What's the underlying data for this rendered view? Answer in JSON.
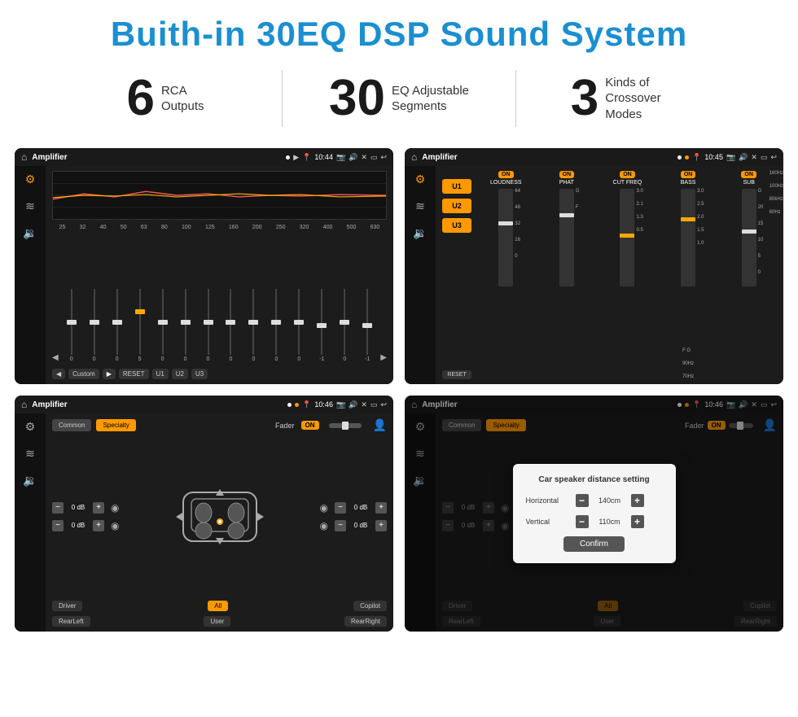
{
  "header": {
    "title": "Buith-in 30EQ DSP Sound System"
  },
  "stats": [
    {
      "number": "6",
      "label_line1": "RCA",
      "label_line2": "Outputs"
    },
    {
      "number": "30",
      "label_line1": "EQ Adjustable",
      "label_line2": "Segments"
    },
    {
      "number": "3",
      "label_line1": "Kinds of",
      "label_line2": "Crossover Modes"
    }
  ],
  "screens": [
    {
      "id": "eq-screen",
      "status": {
        "app": "Amplifier",
        "time": "10:44"
      },
      "type": "eq",
      "freq_labels": [
        "25",
        "32",
        "40",
        "50",
        "63",
        "80",
        "100",
        "125",
        "160",
        "200",
        "250",
        "320",
        "400",
        "500",
        "630"
      ],
      "eq_values": [
        "0",
        "0",
        "0",
        "5",
        "0",
        "0",
        "0",
        "0",
        "0",
        "0",
        "0",
        "-1",
        "0",
        "-1"
      ],
      "bottom_btns": [
        "Custom",
        "RESET",
        "U1",
        "U2",
        "U3"
      ]
    },
    {
      "id": "crossover-screen",
      "status": {
        "app": "Amplifier",
        "time": "10:45"
      },
      "type": "crossover",
      "presets": [
        "U1",
        "U2",
        "U3"
      ],
      "channels": [
        {
          "toggle": "ON",
          "name": "LOUDNESS"
        },
        {
          "toggle": "ON",
          "name": "PHAT"
        },
        {
          "toggle": "ON",
          "name": "CUT FREQ"
        },
        {
          "toggle": "ON",
          "name": "BASS"
        },
        {
          "toggle": "ON",
          "name": "SUB"
        }
      ],
      "reset_label": "RESET"
    },
    {
      "id": "fader-screen",
      "status": {
        "app": "Amplifier",
        "time": "10:46"
      },
      "type": "fader",
      "tabs": [
        "Common",
        "Specialty"
      ],
      "fader_label": "Fader",
      "fader_toggle": "ON",
      "speaker_values": [
        "0 dB",
        "0 dB",
        "0 dB",
        "0 dB"
      ],
      "bottom_btns": [
        "Driver",
        "All",
        "Copilot",
        "RearLeft",
        "User",
        "RearRight"
      ]
    },
    {
      "id": "distance-screen",
      "status": {
        "app": "Amplifier",
        "time": "10:46"
      },
      "type": "fader-with-dialog",
      "tabs": [
        "Common",
        "Specialty"
      ],
      "dialog": {
        "title": "Car speaker distance setting",
        "horizontal_label": "Horizontal",
        "horizontal_value": "140cm",
        "vertical_label": "Vertical",
        "vertical_value": "110cm",
        "confirm_label": "Confirm"
      },
      "speaker_values": [
        "0 dB",
        "0 dB"
      ],
      "bottom_btns": [
        "Driver",
        "All",
        "Copilot",
        "RearLeft",
        "User",
        "RearRight"
      ]
    }
  ],
  "icons": {
    "home": "⌂",
    "play": "▶",
    "pause": "⏸",
    "back": "◀",
    "forward": "▶",
    "settings": "⚙",
    "camera": "📷",
    "volume": "🔊",
    "menu": "☰",
    "close": "✕",
    "minus": "−",
    "plus": "+"
  }
}
